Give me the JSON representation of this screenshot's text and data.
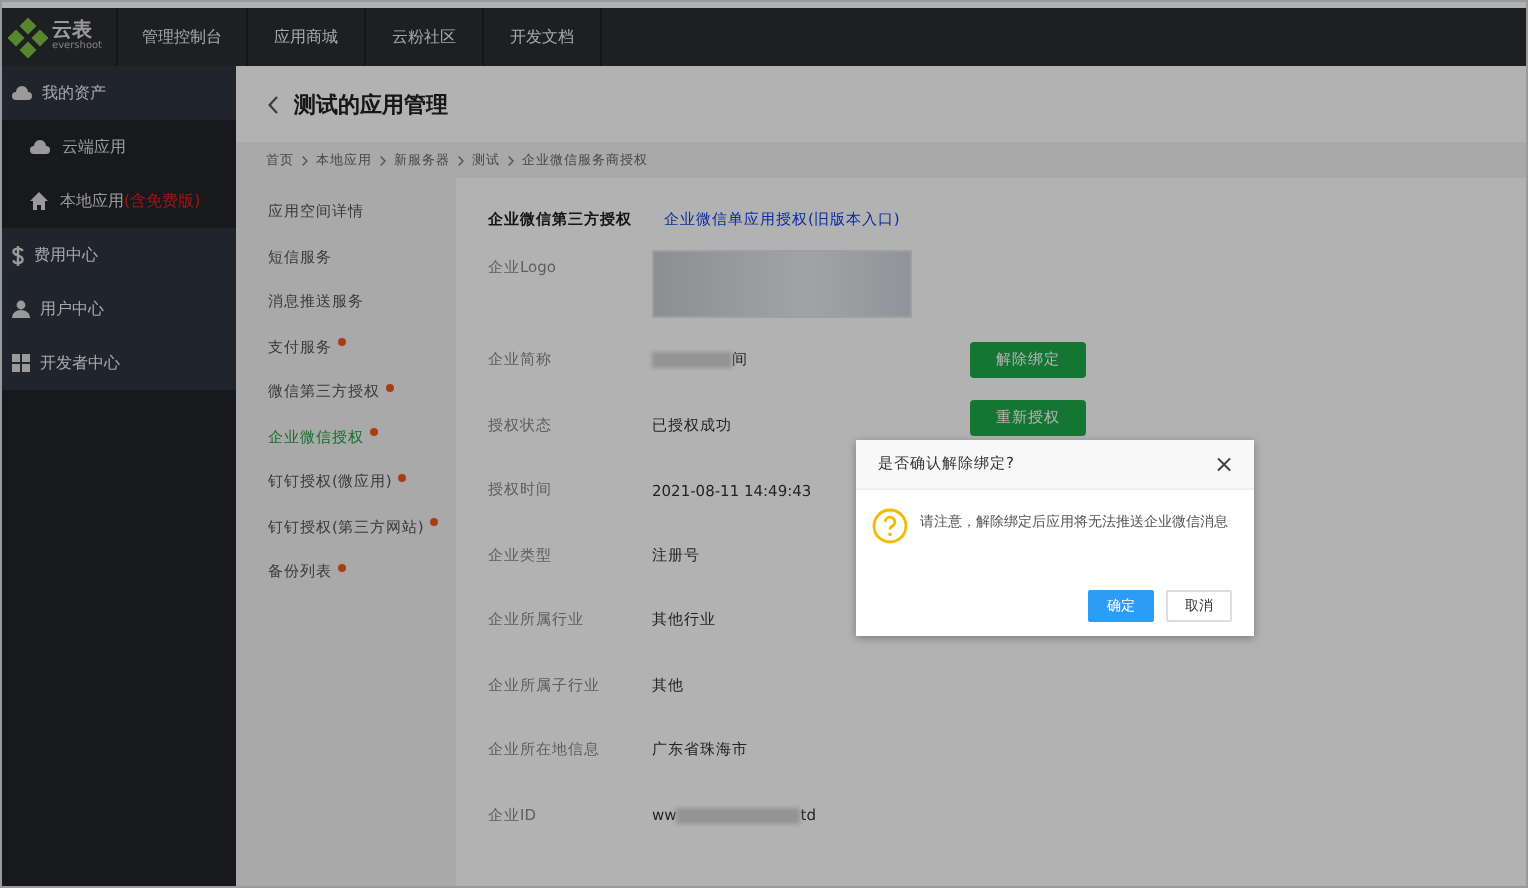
{
  "top_nav": {
    "logo_text": "云表",
    "logo_sub": "evershoot",
    "items": [
      "管理控制台",
      "应用商城",
      "云粉社区",
      "开发文档"
    ]
  },
  "sidebar": {
    "items": [
      {
        "label": "我的资产",
        "children": [
          {
            "label": "云端应用"
          },
          {
            "label": "本地应用",
            "note": "(含免费版)"
          }
        ]
      },
      {
        "label": "费用中心"
      },
      {
        "label": "用户中心"
      },
      {
        "label": "开发者中心"
      }
    ]
  },
  "page_title": "测试的应用管理",
  "breadcrumb": [
    "首页",
    "本地应用",
    "新服务器",
    "测试",
    "企业微信服务商授权"
  ],
  "submenu": [
    {
      "label": "应用空间详情",
      "dot": false,
      "selected": false
    },
    {
      "label": "短信服务",
      "dot": false,
      "selected": false
    },
    {
      "label": "消息推送服务",
      "dot": false,
      "selected": false
    },
    {
      "label": "支付服务",
      "dot": true,
      "selected": false
    },
    {
      "label": "微信第三方授权",
      "dot": true,
      "selected": false
    },
    {
      "label": "企业微信授权",
      "dot": true,
      "selected": true
    },
    {
      "label": "钉钉授权(微应用)",
      "dot": true,
      "selected": false
    },
    {
      "label": "钉钉授权(第三方网站)",
      "dot": true,
      "selected": false
    },
    {
      "label": "备份列表",
      "dot": true,
      "selected": false
    }
  ],
  "tabs": [
    {
      "label": "企业微信第三方授权",
      "selected": true
    },
    {
      "label": "企业微信单应用授权(旧版本入口)",
      "selected": false
    }
  ],
  "fields": [
    {
      "kind": "logo",
      "label": "企业Logo"
    },
    {
      "kind": "masked_start",
      "label": "企业简称",
      "value": "间",
      "button": "解除绑定"
    },
    {
      "kind": "text",
      "label": "授权状态",
      "value": "已授权成功",
      "button": "重新授权"
    },
    {
      "kind": "text",
      "label": "授权时间",
      "value": "2021-08-11 14:49:43"
    },
    {
      "kind": "text",
      "label": "企业类型",
      "value": "注册号"
    },
    {
      "kind": "text",
      "label": "企业所属行业",
      "value": "其他行业"
    },
    {
      "kind": "text",
      "label": "企业所属子行业",
      "value": "其他"
    },
    {
      "kind": "text",
      "label": "企业所在地信息",
      "value": "广东省珠海市"
    },
    {
      "kind": "masked_middle",
      "label": "企业ID",
      "value": "ww",
      "value_end": "td"
    }
  ],
  "dialog": {
    "title": "是否确认解除绑定?",
    "close": "×",
    "message": "请注意，解除绑定后应用将无法推送企业微信消息",
    "buttons": [
      {
        "label": "确定",
        "kind": "primary"
      },
      {
        "label": "取消",
        "kind": "default"
      }
    ]
  }
}
